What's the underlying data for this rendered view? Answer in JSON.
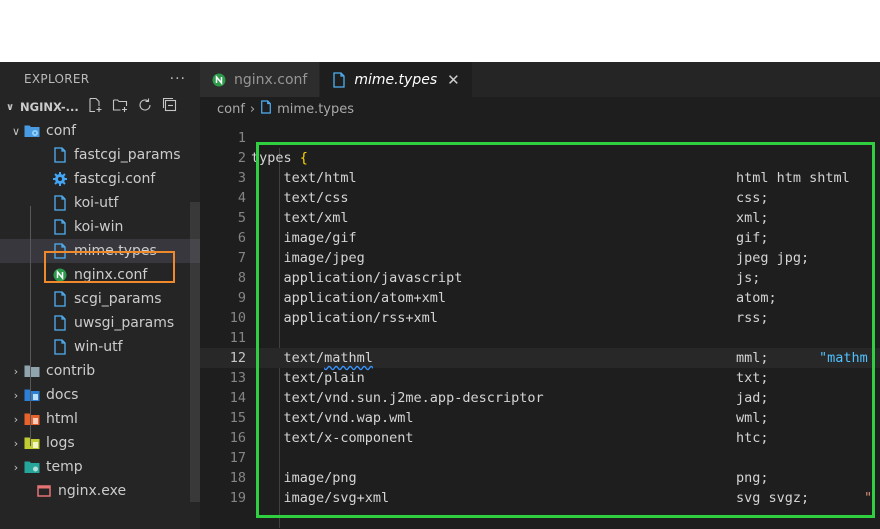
{
  "explorer": {
    "title": "EXPLORER",
    "more_label": "···",
    "section_title": "NGINX-...",
    "items": [
      {
        "label": "conf",
        "type": "folder-open",
        "icon": "folder-gear-icon",
        "color": "#4a9ae1"
      },
      {
        "label": "fastcgi_params",
        "type": "file",
        "icon": "file-icon"
      },
      {
        "label": "fastcgi.conf",
        "type": "file",
        "icon": "gear-icon"
      },
      {
        "label": "koi-utf",
        "type": "file",
        "icon": "file-icon"
      },
      {
        "label": "koi-win",
        "type": "file",
        "icon": "file-icon"
      },
      {
        "label": "mime.types",
        "type": "file",
        "icon": "file-icon",
        "selected": true
      },
      {
        "label": "nginx.conf",
        "type": "file",
        "icon": "nginx-icon"
      },
      {
        "label": "scgi_params",
        "type": "file",
        "icon": "file-icon"
      },
      {
        "label": "uwsgi_params",
        "type": "file",
        "icon": "file-icon"
      },
      {
        "label": "win-utf",
        "type": "file",
        "icon": "file-icon"
      },
      {
        "label": "contrib",
        "type": "folder",
        "icon": "folder-icon"
      },
      {
        "label": "docs",
        "type": "folder",
        "icon": "folder-docs-icon"
      },
      {
        "label": "html",
        "type": "folder",
        "icon": "folder-html-icon"
      },
      {
        "label": "logs",
        "type": "folder",
        "icon": "folder-logs-icon"
      },
      {
        "label": "temp",
        "type": "folder",
        "icon": "folder-temp-icon"
      },
      {
        "label": "nginx.exe",
        "type": "file",
        "icon": "exe-icon"
      }
    ]
  },
  "tabs": [
    {
      "label": "nginx.conf",
      "icon": "nginx-icon",
      "active": false
    },
    {
      "label": "mime.types",
      "icon": "file-icon",
      "active": true,
      "close": "✕"
    }
  ],
  "breadcrumb": {
    "folder": "conf",
    "separator": "›",
    "file": "mime.types"
  },
  "editor": {
    "current_line": 12,
    "lines": [
      {
        "n": "1",
        "code": "",
        "ext": "",
        "extra": ""
      },
      {
        "n": "2",
        "code": "types {",
        "ext": "",
        "extra": ""
      },
      {
        "n": "3",
        "code": "    text/html",
        "ext": "html htm shtml",
        "extra": ""
      },
      {
        "n": "4",
        "code": "    text/css",
        "ext": "css;",
        "extra": ""
      },
      {
        "n": "5",
        "code": "    text/xml",
        "ext": "xml;",
        "extra": ""
      },
      {
        "n": "6",
        "code": "    image/gif",
        "ext": "gif;",
        "extra": ""
      },
      {
        "n": "7",
        "code": "    image/jpeg",
        "ext": "jpeg jpg;",
        "extra": ""
      },
      {
        "n": "8",
        "code": "    application/javascript",
        "ext": "js;",
        "extra": ""
      },
      {
        "n": "9",
        "code": "    application/atom+xml",
        "ext": "atom;",
        "extra": ""
      },
      {
        "n": "10",
        "code": "    application/rss+xml",
        "ext": "rss;",
        "extra": ""
      },
      {
        "n": "11",
        "code": "",
        "ext": "",
        "extra": ""
      },
      {
        "n": "12",
        "code": "    text/mathml",
        "ext": "mml;",
        "extra": "\"mathm"
      },
      {
        "n": "13",
        "code": "    text/plain",
        "ext": "txt;",
        "extra": ""
      },
      {
        "n": "14",
        "code": "    text/vnd.sun.j2me.app-descriptor",
        "ext": "jad;",
        "extra": ""
      },
      {
        "n": "15",
        "code": "    text/vnd.wap.wml",
        "ext": "wml;",
        "extra": ""
      },
      {
        "n": "16",
        "code": "    text/x-component",
        "ext": "htc;",
        "extra": ""
      },
      {
        "n": "17",
        "code": "",
        "ext": "",
        "extra": ""
      },
      {
        "n": "18",
        "code": "    image/png",
        "ext": "png;",
        "extra": ""
      },
      {
        "n": "19",
        "code": "    image/svg+xml",
        "ext": "svg svgz;",
        "extra": "\""
      }
    ]
  },
  "colors": {
    "orange_highlight": "#f0892c",
    "green_highlight": "#2fcf3f"
  }
}
